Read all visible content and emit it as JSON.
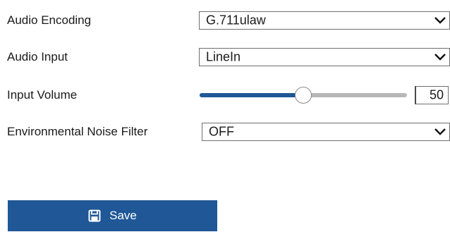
{
  "rows": [
    {
      "label": "Audio Encoding",
      "value": "G.711ulaw"
    },
    {
      "label": "Audio Input",
      "value": "LineIn"
    },
    {
      "label": "Input Volume",
      "value": "50",
      "level_percent": 50
    },
    {
      "label": "Environmental Noise Filter",
      "value": "OFF"
    }
  ],
  "save_button": {
    "label": "Save",
    "icon": "save-icon"
  },
  "colors": {
    "accent": "#1f5797",
    "track": "#b7b7b7",
    "border": "#6f6f6f"
  }
}
